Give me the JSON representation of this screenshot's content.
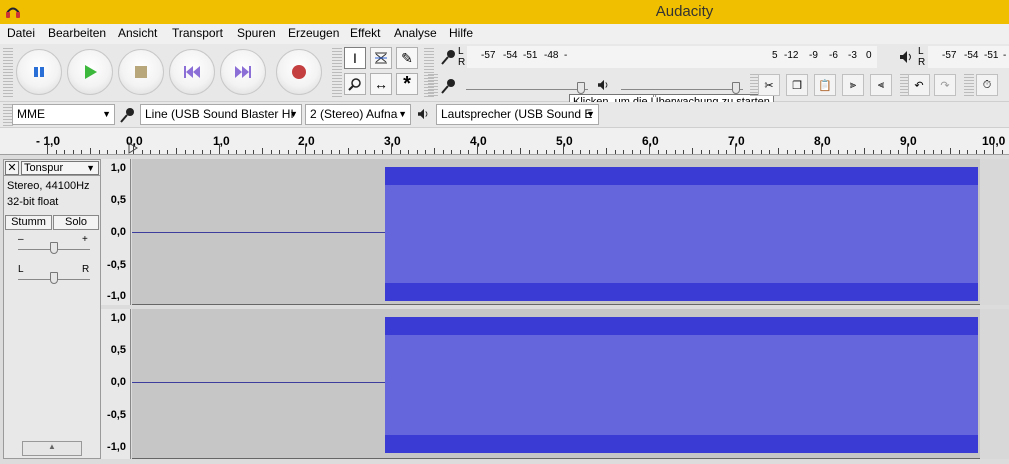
{
  "window": {
    "title": "Audacity"
  },
  "menu": [
    "Datei",
    "Bearbeiten",
    "Ansicht",
    "Transport",
    "Spuren",
    "Erzeugen",
    "Effekt",
    "Analyse",
    "Hilfe"
  ],
  "transport": {
    "pause": "pause-button",
    "play": "play-button",
    "stop": "stop-button",
    "skip_start": "skip-to-start-button",
    "skip_end": "skip-to-end-button",
    "record": "record-button"
  },
  "meters": {
    "record_scale": [
      "-57",
      "-54",
      "-51",
      "-48",
      "-"
    ],
    "record_scale_right": [
      "5",
      "-12",
      "-9",
      "-6",
      "-3",
      "0"
    ],
    "tooltip": "Klicken, um die Überwachung zu starten",
    "play_scale": [
      "-57",
      "-54",
      "-51",
      "-"
    ],
    "lr_top": "L",
    "lr_bottom": "R"
  },
  "devices": {
    "host": "MME",
    "input": "Line (USB Sound Blaster HI",
    "channels": "2 (Stereo) Aufna",
    "output": "Lautsprecher (USB Sound E"
  },
  "ruler": {
    "labels": [
      "- 1,0",
      "0,0",
      "1,0",
      "2,0",
      "3,0",
      "4,0",
      "5,0",
      "6,0",
      "7,0",
      "8,0",
      "9,0",
      "10,0"
    ]
  },
  "track": {
    "name": "Tonspur",
    "format": "Stereo, 44100Hz",
    "bitdepth": "32-bit float",
    "mute": "Stumm",
    "solo": "Solo",
    "gain_minus": "–",
    "gain_plus": "+",
    "pan_left": "L",
    "pan_right": "R",
    "channel_scale": [
      "1,0",
      "0,5",
      "0,0",
      "-0,5",
      "-1,0"
    ]
  },
  "colors": {
    "titlebar": "#f0c000",
    "wave": "#6565dc",
    "wave_dark": "#3a3ad4",
    "track_bg": "#c6c6c6"
  }
}
